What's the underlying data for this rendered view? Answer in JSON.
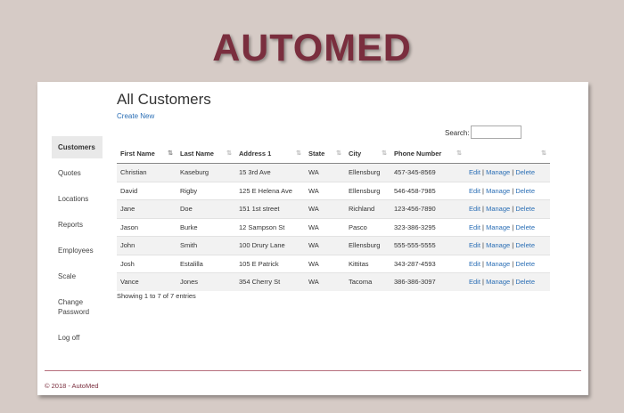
{
  "brand": {
    "title": "AUTOMED"
  },
  "page": {
    "title": "All Customers",
    "create_new": "Create New"
  },
  "search": {
    "label": "Search:",
    "placeholder": ""
  },
  "sidebar": {
    "items": [
      {
        "label": "Customers",
        "active": true
      },
      {
        "label": "Quotes"
      },
      {
        "label": "Locations"
      },
      {
        "label": "Reports"
      },
      {
        "label": "Employees"
      },
      {
        "label": "Scale"
      },
      {
        "label": "Change Password"
      },
      {
        "label": "Log off"
      }
    ]
  },
  "table": {
    "columns": [
      "First Name",
      "Last Name",
      "Address 1",
      "State",
      "City",
      "Phone Number",
      ""
    ],
    "sorted_column": "First Name",
    "action_labels": {
      "edit": "Edit",
      "manage": "Manage",
      "delete": "Delete",
      "sep": "|"
    },
    "rows": [
      [
        "Christian",
        "Kaseburg",
        "15 3rd Ave",
        "WA",
        "Ellensburg",
        "457-345-8569"
      ],
      [
        "David",
        "Rigby",
        "125 E Helena Ave",
        "WA",
        "Ellensburg",
        "546-458-7985"
      ],
      [
        "Jane",
        "Doe",
        "151 1st street",
        "WA",
        "Richland",
        "123-456-7890"
      ],
      [
        "Jason",
        "Burke",
        "12 Sampson St",
        "WA",
        "Pasco",
        "323-386-3295"
      ],
      [
        "John",
        "Smith",
        "100 Drury Lane",
        "WA",
        "Ellensburg",
        "555-555-5555"
      ],
      [
        "Josh",
        "Estalilla",
        "105 E Patrick",
        "WA",
        "Kittitas",
        "343-287-4593"
      ],
      [
        "Vance",
        "Jones",
        "354 Cherry St",
        "WA",
        "Tacoma",
        "386-386-3097"
      ]
    ]
  },
  "info": {
    "text": "Showing 1 to 7 of 7 entries"
  },
  "footer": {
    "text": "© 2018 - AutoMed"
  },
  "colors": {
    "brand": "#7a2e3e",
    "link": "#2a6eb5",
    "background": "#d6cbc6"
  }
}
